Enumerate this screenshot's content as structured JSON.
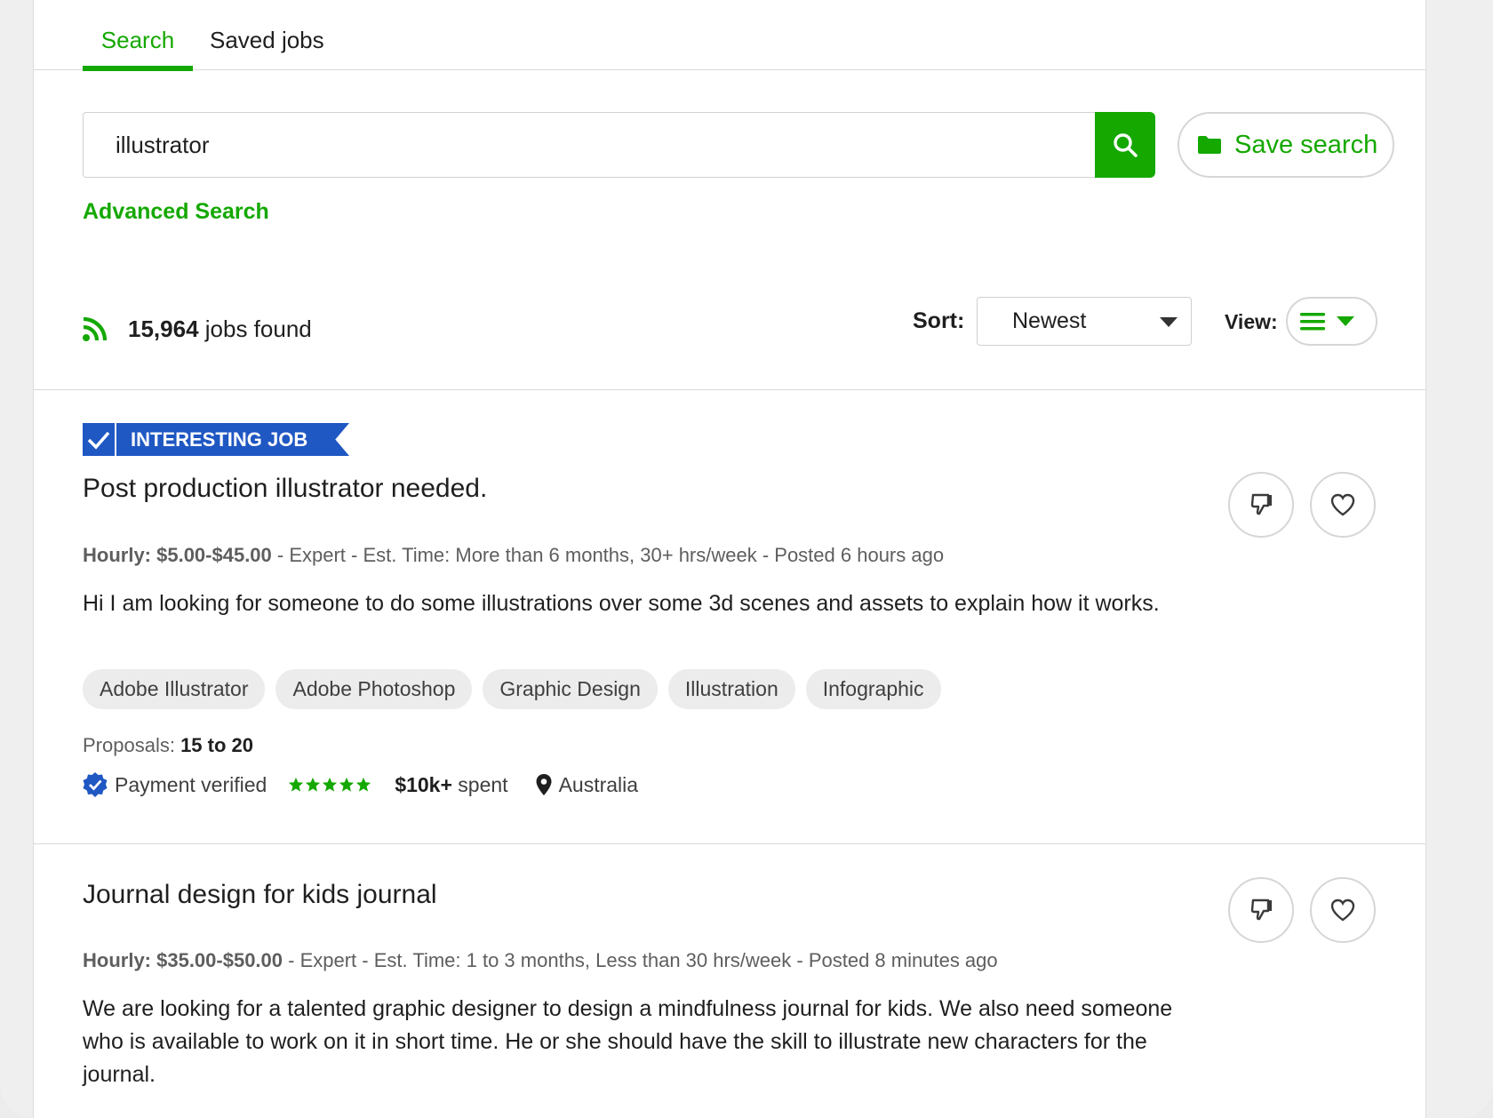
{
  "tabs": [
    {
      "label": "Search"
    },
    {
      "label": "Saved jobs"
    }
  ],
  "search": {
    "value": "illustrator",
    "save_label": "Save search",
    "advanced_label": "Advanced Search"
  },
  "results": {
    "count": "15,964",
    "count_suffix": " jobs found",
    "sort_label": "Sort:",
    "sort_value": "Newest",
    "view_label": "View:"
  },
  "colors": {
    "accent": "#14a800",
    "badge": "#1f57c3"
  },
  "jobs": [
    {
      "badge": "INTERESTING JOB",
      "title": "Post production illustrator needed.",
      "rate": "Hourly: $5.00-$45.00",
      "meta_rest": " - Expert - Est. Time: More than 6 months, 30+ hrs/week - Posted 6 hours ago",
      "description": "Hi I am looking for someone to do some illustrations over some 3d scenes and assets to explain how it works.",
      "skills": [
        "Adobe Illustrator",
        "Adobe Photoshop",
        "Graphic Design",
        "Illustration",
        "Infographic"
      ],
      "proposals_label": "Proposals: ",
      "proposals_value": "15 to 20",
      "payment": "Payment verified",
      "rating": 5,
      "spent_amount": "$10k+",
      "spent_suffix": " spent",
      "location": "Australia"
    },
    {
      "title": "Journal design for kids journal",
      "rate": "Hourly: $35.00-$50.00",
      "meta_rest": " - Expert - Est. Time: 1 to 3 months, Less than 30 hrs/week - Posted 8 minutes ago",
      "description": "We are looking for a talented graphic designer to design a mindfulness journal for kids. We also need someone who is available to work on it in short time. He or she should have the skill to illustrate new characters for the journal."
    }
  ]
}
